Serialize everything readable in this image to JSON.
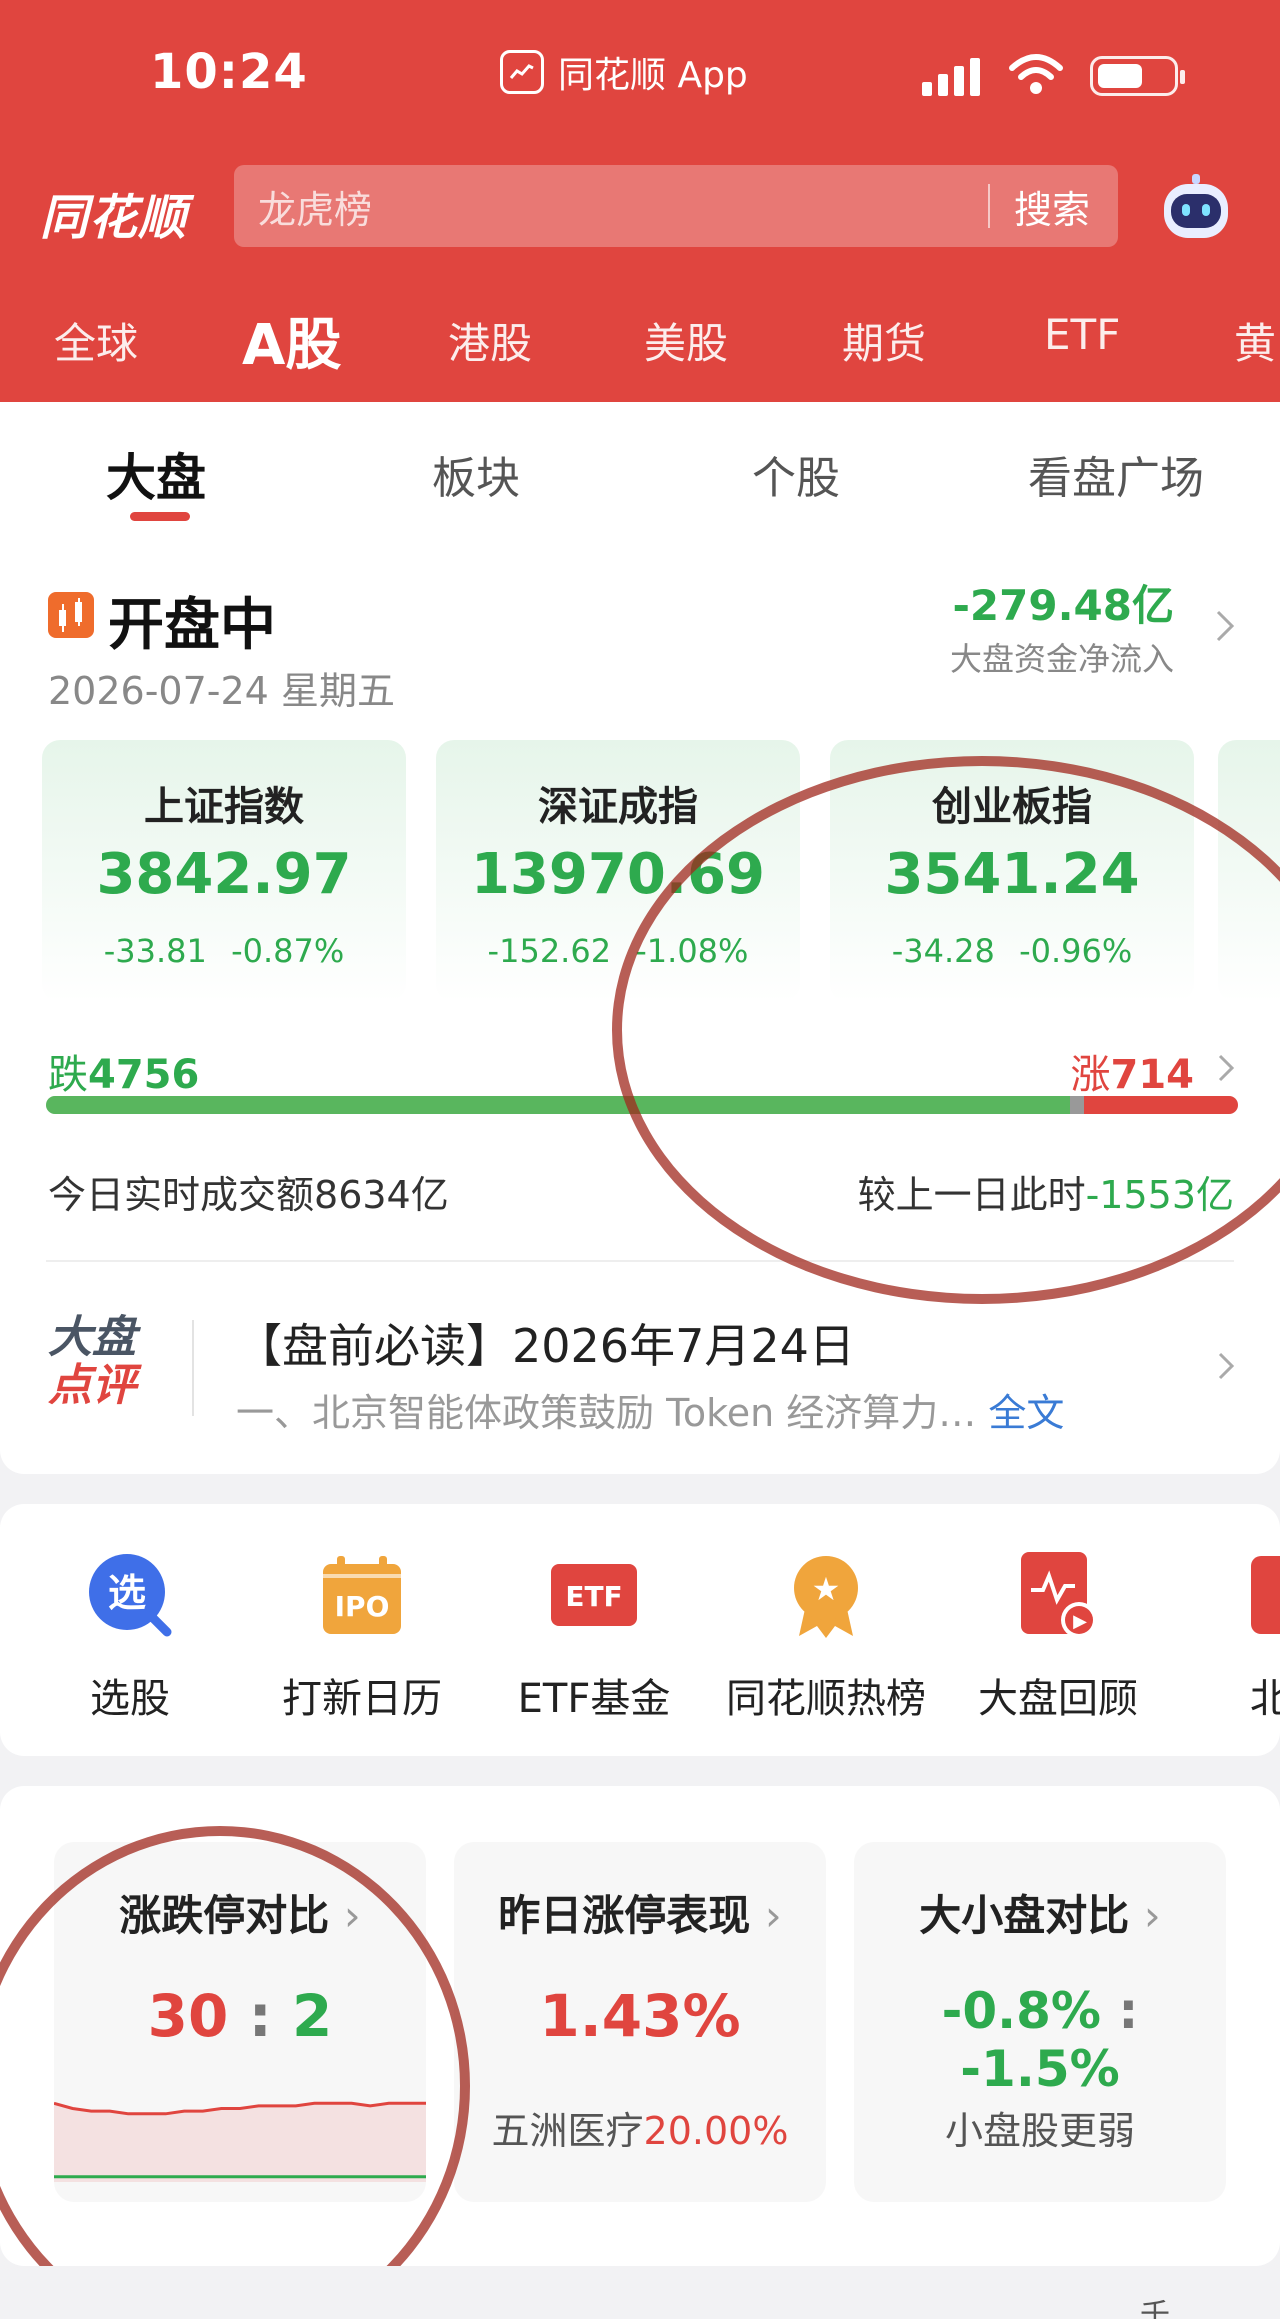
{
  "status_bar": {
    "time": "10:24",
    "app_name": "同花顺 App"
  },
  "header": {
    "brand": "同花顺",
    "search_placeholder": "龙虎榜",
    "search_button": "搜索",
    "market_tabs": [
      "全球",
      "A股",
      "港股",
      "美股",
      "期货",
      "ETF",
      "黄"
    ],
    "active_market_tab": "A股"
  },
  "sub_tabs": [
    "大盘",
    "板块",
    "个股",
    "看盘广场"
  ],
  "market_overview": {
    "status": "开盘中",
    "date": "2026-07-24",
    "weekday": "星期五",
    "net_flow_value": "-279.48亿",
    "net_flow_label": "大盘资金净流入",
    "indices": [
      {
        "name": "上证指数",
        "value": "3842.97",
        "change": "-33.81",
        "percent": "-0.87%"
      },
      {
        "name": "深证成指",
        "value": "13970.69",
        "change": "-152.62",
        "percent": "-1.08%"
      },
      {
        "name": "创业板指",
        "value": "3541.24",
        "change": "-34.28",
        "percent": "-0.96%"
      }
    ],
    "fall_label": "跌",
    "fall_count": "4756",
    "rise_label": "涨",
    "rise_count": "714",
    "turnover_label": "今日实时成交额",
    "turnover_value": "8634亿",
    "compare_label": "较上一日此时",
    "compare_value": "-1553亿"
  },
  "review": {
    "logo_line1": "大盘",
    "logo_line2": "点评",
    "title": "【盘前必读】2026年7月24日",
    "summary": "一、北京智能体政策鼓励 Token 经济算力…",
    "full_text_link": "全文"
  },
  "shortcuts": [
    {
      "label": "选股",
      "icon": "select-stock-icon",
      "glyph": "选"
    },
    {
      "label": "打新日历",
      "icon": "ipo-calendar-icon",
      "glyph": "IPO"
    },
    {
      "label": "ETF基金",
      "icon": "etf-fund-icon",
      "glyph": "ETF"
    },
    {
      "label": "同花顺热榜",
      "icon": "hot-list-icon",
      "glyph": "★"
    },
    {
      "label": "大盘回顾",
      "icon": "market-review-icon",
      "glyph": "▶"
    },
    {
      "label": "北交",
      "icon": "bse-icon",
      "glyph": ""
    }
  ],
  "stats": {
    "limit_compare": {
      "title": "涨跌停对比",
      "up": "30",
      "separator": ":",
      "down": "2"
    },
    "yesterday_limit": {
      "title": "昨日涨停表现",
      "value": "1.43%",
      "stock": "五洲医疗",
      "stock_value": "20.00%"
    },
    "cap_compare": {
      "title": "大小盘对比",
      "large": "-0.8%",
      "separator": ":",
      "small": "-1.5%",
      "note": "小盘股更弱"
    }
  },
  "mini_chart": {
    "series": [
      {
        "color": "#e0453f",
        "values": [
          30,
          28,
          27,
          27,
          26,
          26,
          26,
          27,
          27,
          28,
          28,
          29,
          29,
          29,
          30,
          30,
          30,
          29,
          30,
          30,
          30
        ]
      },
      {
        "color": "#2eaa4e",
        "values": [
          2,
          2,
          2,
          2,
          2,
          2,
          2,
          2,
          2,
          2,
          2,
          2,
          2,
          2,
          2,
          2,
          2,
          2,
          2,
          2,
          2
        ]
      }
    ]
  },
  "colors": {
    "brand_red": "#e0453f",
    "fall_green": "#2eaa4e",
    "link_blue": "#3a7bd5"
  },
  "footer_text": "千"
}
